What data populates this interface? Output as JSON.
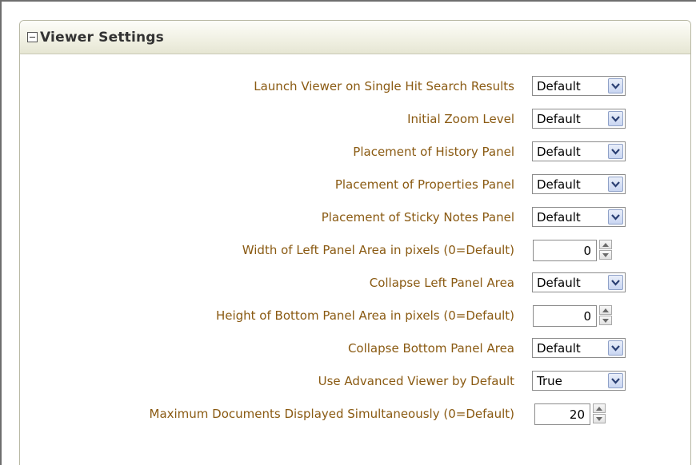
{
  "panel": {
    "title": "Viewer Settings"
  },
  "colors": {
    "label": "#8a5a12",
    "header_gradient_top": "#fdfdf9",
    "header_gradient_bottom": "#e6e6d3",
    "dropdown_button": "#c9d6f2"
  },
  "settings": [
    {
      "label": "Launch Viewer on Single Hit Search Results",
      "control": "select",
      "value": "Default"
    },
    {
      "label": "Initial Zoom Level",
      "control": "select",
      "value": "Default"
    },
    {
      "label": "Placement of History Panel",
      "control": "select",
      "value": "Default"
    },
    {
      "label": "Placement of Properties Panel",
      "control": "select",
      "value": "Default"
    },
    {
      "label": "Placement of Sticky Notes Panel",
      "control": "select",
      "value": "Default"
    },
    {
      "label": "Width of Left Panel Area in pixels (0=Default)",
      "control": "spinner",
      "value": "0"
    },
    {
      "label": "Collapse Left Panel Area",
      "control": "select",
      "value": "Default"
    },
    {
      "label": "Height of Bottom Panel Area in pixels (0=Default)",
      "control": "spinner",
      "value": "0"
    },
    {
      "label": "Collapse Bottom Panel Area",
      "control": "select",
      "value": "Default"
    },
    {
      "label": "Use Advanced Viewer by Default",
      "control": "select",
      "value": "True"
    },
    {
      "label": "Maximum Documents Displayed Simultaneously (0=Default)",
      "control": "spinner",
      "value": "20"
    }
  ]
}
